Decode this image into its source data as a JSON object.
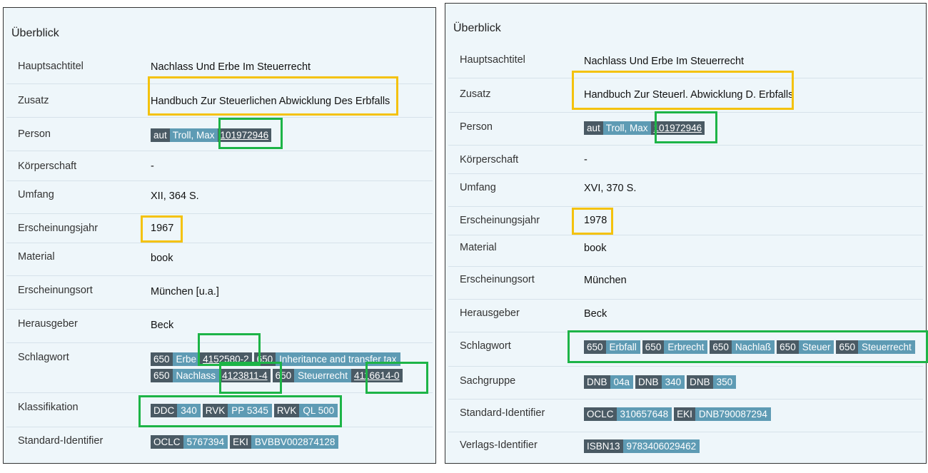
{
  "colors": {
    "panel_bg": "#eef6fa",
    "chip_key": "#4a5a64",
    "chip_value": "#5e9bb4",
    "highlight_yellow": "#f4c20d",
    "highlight_green": "#1db447"
  },
  "left": {
    "title": "Überblick",
    "hauptsachtitel": {
      "label": "Hauptsachtitel",
      "value": "Nachlass Und Erbe Im Steuerrecht"
    },
    "zusatz": {
      "label": "Zusatz",
      "value": "Handbuch Zur Steuerlichen Abwicklung Des Erbfalls"
    },
    "person": {
      "label": "Person",
      "role": "aut",
      "name": "Troll, Max",
      "gnd": "101972946"
    },
    "koerperschaft": {
      "label": "Körperschaft",
      "value": "-"
    },
    "umfang": {
      "label": "Umfang",
      "value": "XII, 364 S."
    },
    "erscheinungsjahr": {
      "label": "Erscheinungsjahr",
      "value": "1967"
    },
    "material": {
      "label": "Material",
      "value": "book"
    },
    "erscheinungsort": {
      "label": "Erscheinungsort",
      "value": "München [u.a.]"
    },
    "herausgeber": {
      "label": "Herausgeber",
      "value": "Beck"
    },
    "schlagwort": {
      "label": "Schlagwort",
      "chips": [
        {
          "k": "650",
          "v": "Erbe",
          "id": "4152580-2"
        },
        {
          "k": "650",
          "v": "Inheritance and transfer tax"
        },
        {
          "k": "650",
          "v": "Nachlass",
          "id": "4123811-4"
        },
        {
          "k": "650",
          "v": "Steuerrecht",
          "id": "4116614-0"
        }
      ]
    },
    "klassifikation": {
      "label": "Klassifikation",
      "chips": [
        {
          "k": "DDC",
          "v": "340"
        },
        {
          "k": "RVK",
          "v": "PP 5345"
        },
        {
          "k": "RVK",
          "v": "QL 500"
        }
      ]
    },
    "standard_identifier": {
      "label": "Standard-Identifier",
      "chips": [
        {
          "k": "OCLC",
          "v": "5767394"
        },
        {
          "k": "EKI",
          "v": "BVBBV002874128"
        }
      ]
    }
  },
  "right": {
    "title": "Überblick",
    "hauptsachtitel": {
      "label": "Hauptsachtitel",
      "value": "Nachlass Und Erbe Im Steuerrecht"
    },
    "zusatz": {
      "label": "Zusatz",
      "value": "Handbuch Zur Steuerl. Abwicklung D. Erbfalls"
    },
    "person": {
      "label": "Person",
      "role": "aut",
      "name": "Troll, Max",
      "gnd": "101972946"
    },
    "koerperschaft": {
      "label": "Körperschaft",
      "value": "-"
    },
    "umfang": {
      "label": "Umfang",
      "value": "XVI, 370 S."
    },
    "erscheinungsjahr": {
      "label": "Erscheinungsjahr",
      "value": "1978"
    },
    "material": {
      "label": "Material",
      "value": "book"
    },
    "erscheinungsort": {
      "label": "Erscheinungsort",
      "value": "München"
    },
    "herausgeber": {
      "label": "Herausgeber",
      "value": "Beck"
    },
    "schlagwort": {
      "label": "Schlagwort",
      "chips": [
        {
          "k": "650",
          "v": "Erbfall"
        },
        {
          "k": "650",
          "v": "Erbrecht"
        },
        {
          "k": "650",
          "v": "Nachlaß"
        },
        {
          "k": "650",
          "v": "Steuer"
        },
        {
          "k": "650",
          "v": "Steuerrecht"
        }
      ]
    },
    "sachgruppe": {
      "label": "Sachgruppe",
      "chips": [
        {
          "k": "DNB",
          "v": "04a"
        },
        {
          "k": "DNB",
          "v": "340"
        },
        {
          "k": "DNB",
          "v": "350"
        }
      ]
    },
    "standard_identifier": {
      "label": "Standard-Identifier",
      "chips": [
        {
          "k": "OCLC",
          "v": "310657648"
        },
        {
          "k": "EKI",
          "v": "DNB790087294"
        }
      ]
    },
    "verlags_identifier": {
      "label": "Verlags-Identifier",
      "chips": [
        {
          "k": "ISBN13",
          "v": "9783406029462"
        }
      ]
    }
  }
}
